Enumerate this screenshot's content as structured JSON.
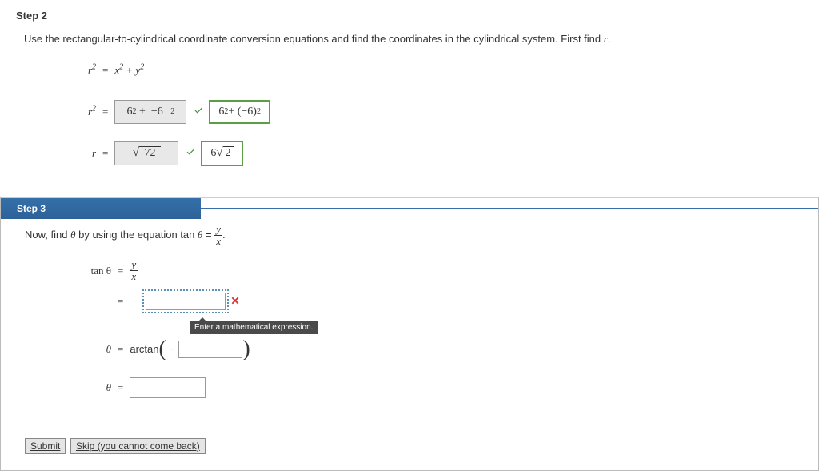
{
  "step2": {
    "label": "Step 2",
    "instruction_pre": "Use the rectangular-to-cylindrical coordinate conversion equations and find the coordinates in the cylindrical system. First find ",
    "instruction_var": "r",
    "instruction_post": ".",
    "eq1": {
      "lhs": "r",
      "rhs_a": "x",
      "rhs_b": "y"
    },
    "eq2": {
      "lhs": "r",
      "input_a": "6",
      "input_b": "−6",
      "correct": "6² + (−6)²"
    },
    "eq3": {
      "lhs": "r",
      "input_radicand": "72",
      "correct_coef": "6",
      "correct_radicand": "2"
    }
  },
  "step3": {
    "label": "Step 3",
    "instruction_pre": "Now, find ",
    "instruction_theta": "θ",
    "instruction_mid": " by using the equation tan ",
    "eq1": {
      "lhs": "tan θ",
      "num": "y",
      "den": "x"
    },
    "eq2_value": "",
    "tooltip": "Enter a mathematical expression.",
    "eq3": {
      "lhs": "θ",
      "func": "arctan",
      "value": ""
    },
    "eq4": {
      "lhs": "θ",
      "value": ""
    }
  },
  "buttons": {
    "submit": "Submit",
    "skip": "Skip (you cannot come back)"
  }
}
